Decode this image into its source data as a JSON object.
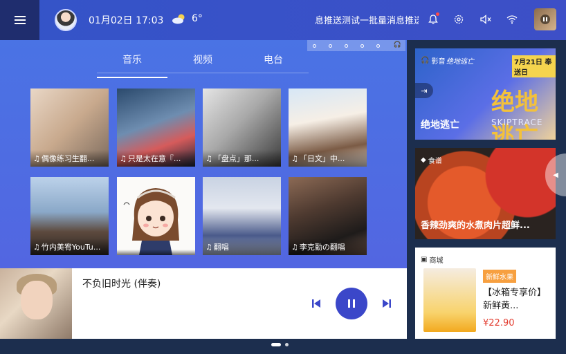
{
  "topbar": {
    "date_time": "01月02日  17:03",
    "temperature": "6°",
    "marquee": "息推送测试一批量消息推送",
    "icons": [
      "menu-icon",
      "bell-icon",
      "gear-icon",
      "mute-icon",
      "wifi-icon"
    ],
    "accent_color": "#3454c8"
  },
  "tabs": [
    {
      "label": "音乐"
    },
    {
      "label": "视频"
    },
    {
      "label": "电台"
    }
  ],
  "music_cards": [
    {
      "caption": "偶像练习生翻..."
    },
    {
      "caption": "只是太在意『..."
    },
    {
      "caption": "「盘点」那..."
    },
    {
      "caption": "「日文」中..."
    },
    {
      "caption": "竹内美宥YouTu..."
    },
    {
      "caption": ""
    },
    {
      "caption": "翻唱"
    },
    {
      "caption": "李克勤の翻唱"
    }
  ],
  "player": {
    "song_title": "不负旧时光 (伴奏)"
  },
  "right": {
    "movie": {
      "tag": "影音",
      "title": "绝地逃亡",
      "promo": "7月21日 奉送日",
      "brand": "绝地逃亡",
      "big": "绝地逃亡",
      "sub": "SKIPTRACE"
    },
    "food": {
      "tag": "食谱",
      "title": "香辣劲爽的水煮肉片超鲜..."
    },
    "mall": {
      "tag": "商城",
      "badge": "新鲜水果",
      "name": "【冰箱专享价】新鲜黄...",
      "price": "¥22.90"
    }
  }
}
